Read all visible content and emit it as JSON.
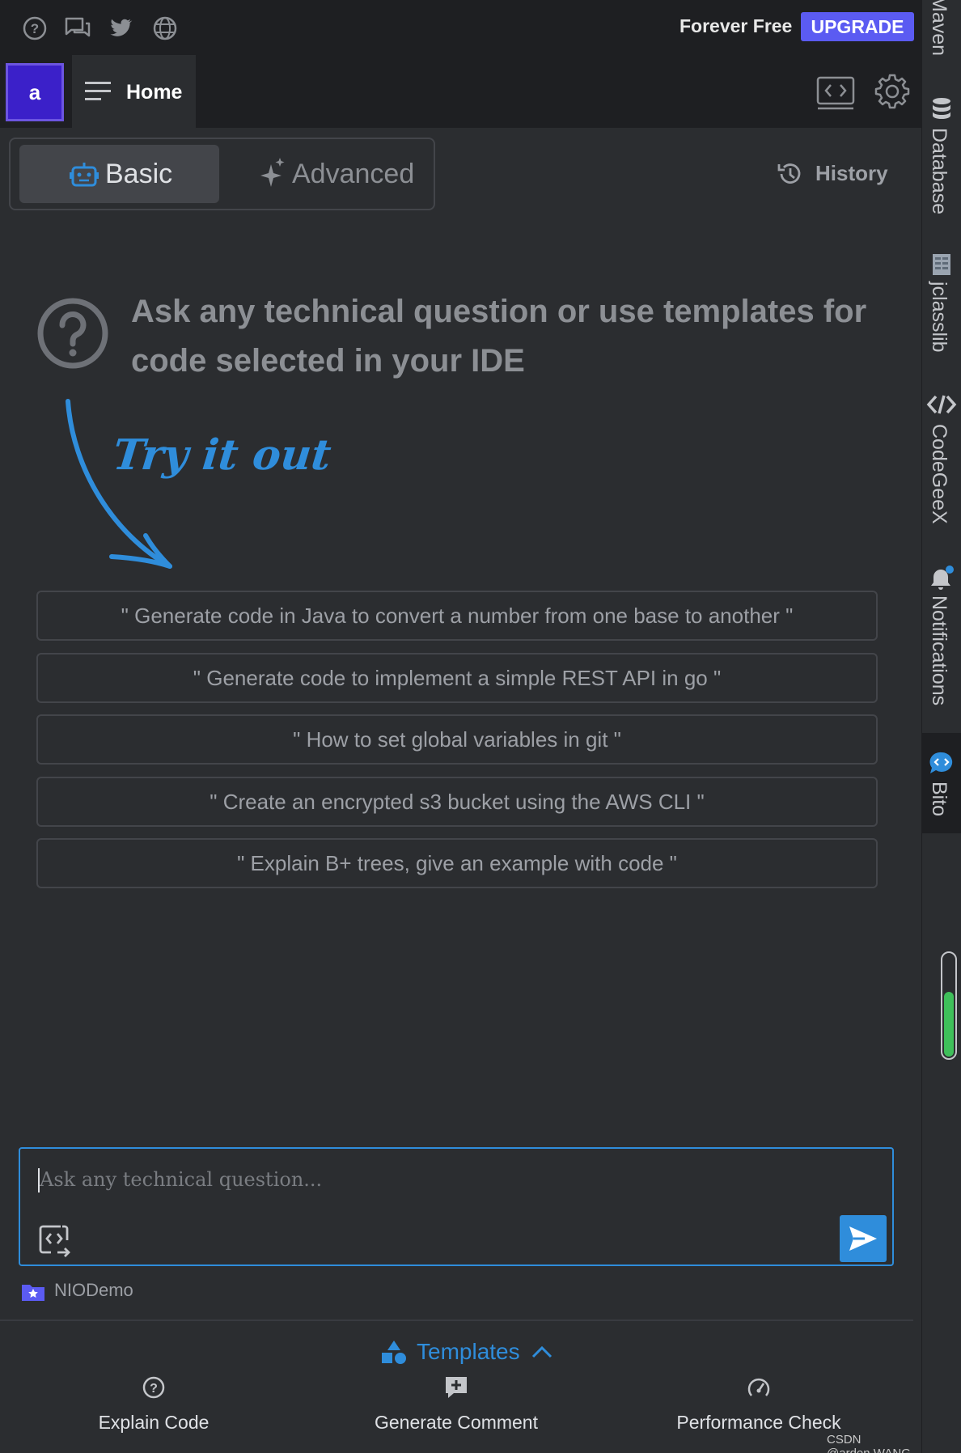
{
  "topbar": {
    "icons": [
      "help-icon",
      "feedback-icon",
      "twitter-icon",
      "globe-icon"
    ],
    "plan_label": "Forever Free",
    "upgrade_label": "UPGRADE"
  },
  "tabs": {
    "avatar_letter": "a",
    "home_label": "Home"
  },
  "mode": {
    "basic_label": "Basic",
    "advanced_label": "Advanced",
    "history_label": "History"
  },
  "intro": {
    "text": "Ask any technical question or use templates for code selected in your IDE",
    "try_label": "Try it out"
  },
  "suggestions": [
    "\" Generate code in Java to convert a number from one base to another \"",
    "\" Generate code to implement a simple REST API in go \"",
    "\" How to set global variables in git \"",
    "\" Create an encrypted s3 bucket using the AWS CLI \"",
    "\" Explain B+ trees, give an example with code \""
  ],
  "input": {
    "placeholder": "Ask any technical question..."
  },
  "project": {
    "name": "NIODemo"
  },
  "templates": {
    "label": "Templates",
    "actions": [
      "Explain Code",
      "Generate Comment",
      "Performance Check"
    ]
  },
  "rightbar": {
    "tabs": [
      "Maven",
      "Database",
      "jclasslib",
      "CodeGeeX",
      "Notifications",
      "Bito"
    ]
  },
  "watermark": "CSDN @arden.WANG",
  "colors": {
    "accent": "#2f8ddb",
    "upgrade": "#5b5bf2",
    "avatar": "#3b20c9",
    "memory_indicator": "#3fbf5a"
  }
}
